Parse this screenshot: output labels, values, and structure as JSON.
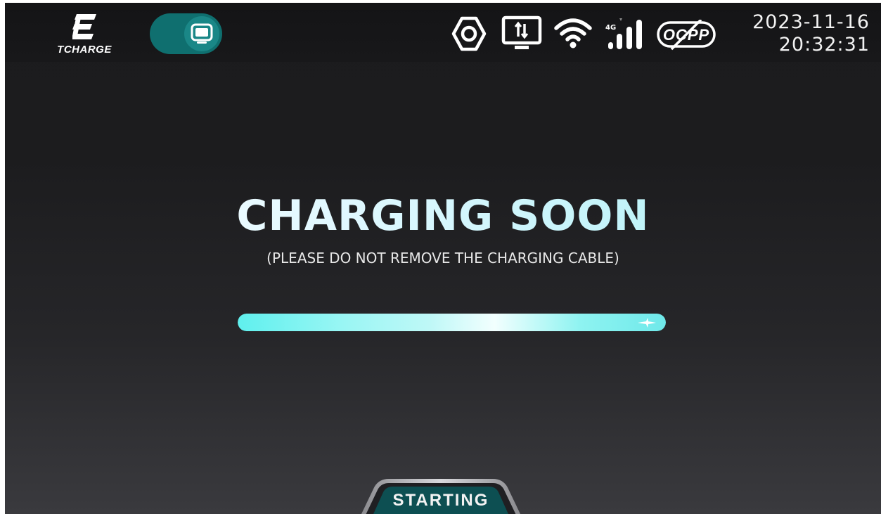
{
  "brand": {
    "name": "TCHARGE"
  },
  "header": {
    "date": "2023-11-16",
    "time": "20:32:31",
    "signal_label": "4G",
    "ocpp_label": "OCPP",
    "icons": [
      "settings-nut-icon",
      "screen-transfer-icon",
      "wifi-icon",
      "4g-signal-icon",
      "ocpp-disconnected-icon"
    ]
  },
  "main": {
    "title": "CHARGING SOON",
    "subtitle": "(PLEASE DO NOT REMOVE THE CHARGING CABLE)",
    "progress": 1.0
  },
  "footer": {
    "status_tab": "STARTING"
  },
  "colors": {
    "accent": "#5ff0ee",
    "toggle_bg": "#0f6f6f",
    "background_top": "#1b1b1d",
    "background_bottom": "#3a3a3e"
  }
}
